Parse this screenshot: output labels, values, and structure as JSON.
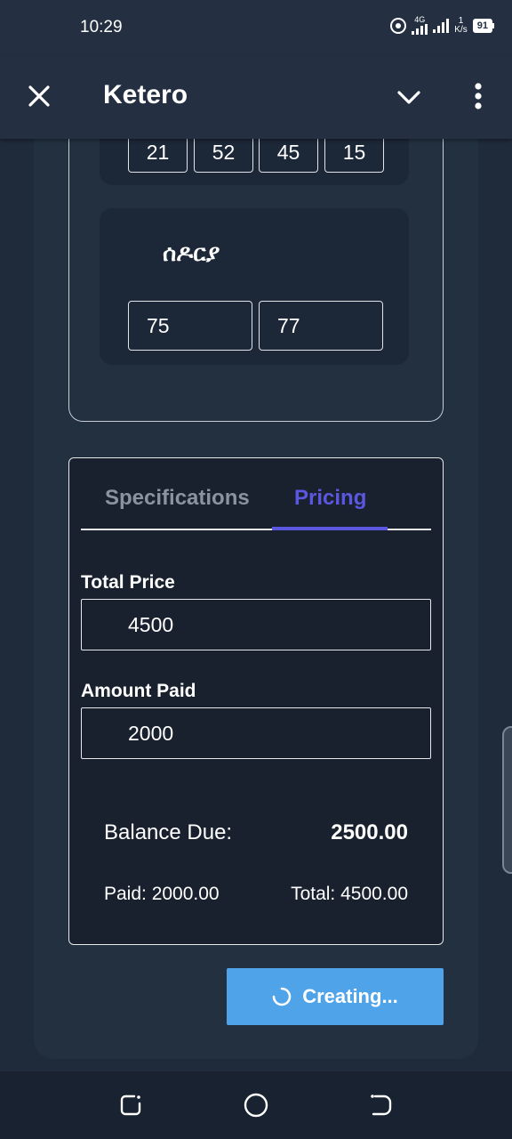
{
  "status_bar": {
    "time": "10:29",
    "network_type": "4G",
    "speed_value": "1",
    "speed_unit": "K/s",
    "battery": "91",
    "icons": [
      "hotspot-icon",
      "signal-icon",
      "signal-icon",
      "battery-icon"
    ]
  },
  "app_bar": {
    "title": "Ketero",
    "icons": [
      "close-icon",
      "chevron-down-icon",
      "more-vert-icon"
    ]
  },
  "top_numbers": [
    "21",
    "52",
    "45",
    "15"
  ],
  "section": {
    "label": "ሰዶርያ",
    "values": [
      "75",
      "77"
    ]
  },
  "pricing": {
    "tabs": [
      {
        "label": "Specifications",
        "active": false
      },
      {
        "label": "Pricing",
        "active": true
      }
    ],
    "total_price_label": "Total Price",
    "total_price_value": "4500",
    "amount_paid_label": "Amount Paid",
    "amount_paid_value": "2000",
    "balance_label": "Balance Due:",
    "balance_value": "2500.00",
    "paid_text": "Paid: 2000.00",
    "total_text": "Total: 4500.00"
  },
  "create_button": {
    "label": "Creating...",
    "icon": "spinner-icon"
  },
  "nav_bar": {
    "icons": [
      "recent-apps-icon",
      "home-icon",
      "back-icon"
    ]
  },
  "colors": {
    "background": "#1f2a3a",
    "card": "#19212e",
    "accent": "#5b57e0",
    "button": "#4fa3e8"
  }
}
